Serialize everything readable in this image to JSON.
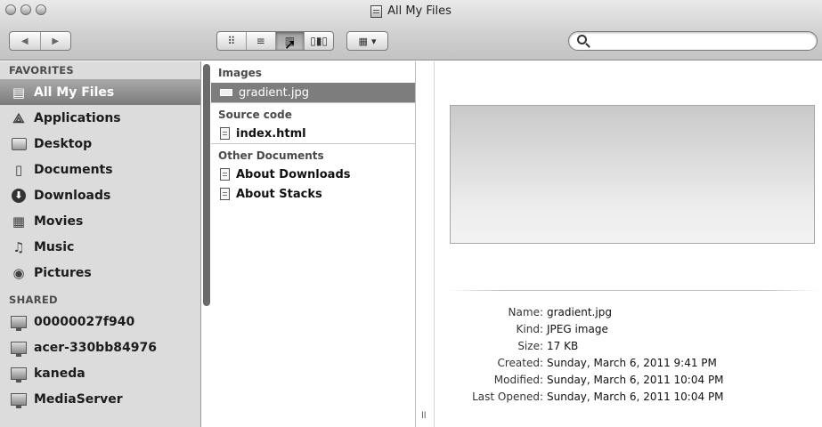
{
  "window": {
    "title": "All My Files"
  },
  "toolbar": {
    "back_glyph": "◀",
    "forward_glyph": "▶",
    "view_modes": [
      {
        "label": "icon-view",
        "glyph": "⠿"
      },
      {
        "label": "list-view",
        "glyph": "≡"
      },
      {
        "label": "column-view",
        "glyph": "▥"
      },
      {
        "label": "coverflow-view",
        "glyph": "▯▮▯"
      }
    ],
    "arrange_glyph": "▦",
    "arrange_chevron": "▾",
    "search": {
      "value": "",
      "placeholder": ""
    }
  },
  "sidebar": {
    "favorites_header": "FAVORITES",
    "favorites": [
      {
        "label": "All My Files",
        "icon": "all-my-files-icon",
        "selected": true
      },
      {
        "label": "Applications",
        "icon": "applications-icon"
      },
      {
        "label": "Desktop",
        "icon": "desktop-icon"
      },
      {
        "label": "Documents",
        "icon": "documents-icon"
      },
      {
        "label": "Downloads",
        "icon": "downloads-icon"
      },
      {
        "label": "Movies",
        "icon": "movies-icon"
      },
      {
        "label": "Music",
        "icon": "music-icon"
      },
      {
        "label": "Pictures",
        "icon": "pictures-icon"
      }
    ],
    "shared_header": "SHARED",
    "shared": [
      {
        "label": "00000027f940",
        "icon": "computer-icon"
      },
      {
        "label": "acer-330bb84976",
        "icon": "computer-icon"
      },
      {
        "label": "kaneda",
        "icon": "computer-icon"
      },
      {
        "label": "MediaServer",
        "icon": "monitor-icon"
      }
    ]
  },
  "files": {
    "groups": [
      {
        "header": "Images",
        "items": [
          "gradient.jpg"
        ]
      },
      {
        "header": "Source code",
        "items": [
          "index.html"
        ]
      },
      {
        "header": "Other Documents",
        "items": [
          "About Downloads",
          "About Stacks"
        ]
      }
    ]
  },
  "preview": {
    "info": [
      {
        "label": "Name:",
        "value": "gradient.jpg"
      },
      {
        "label": "Kind:",
        "value": "JPEG image"
      },
      {
        "label": "Size:",
        "value": "17 KB"
      },
      {
        "label": "Created:",
        "value": "Sunday, March 6, 2011 9:41 PM"
      },
      {
        "label": "Modified:",
        "value": "Sunday, March 6, 2011 10:04 PM"
      },
      {
        "label": "Last Opened:",
        "value": "Sunday, March 6, 2011 10:04 PM"
      }
    ]
  },
  "colors": {
    "sidebar_bg": "#dcdcdc",
    "selection": "#7d7d7d",
    "toolbar_top": "#e9e9e9",
    "toolbar_bottom": "#c3c3c3"
  }
}
